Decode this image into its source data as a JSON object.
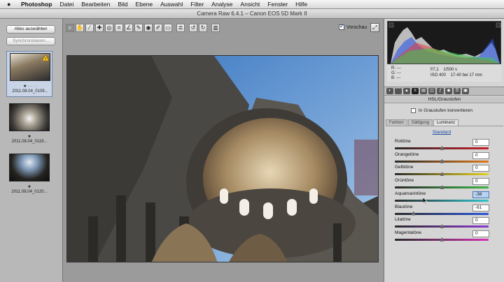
{
  "menubar": {
    "app": "Photoshop",
    "items": [
      "Datei",
      "Bearbeiten",
      "Bild",
      "Ebene",
      "Auswahl",
      "Filter",
      "Analyse",
      "Ansicht",
      "Fenster",
      "Hilfe"
    ]
  },
  "window": {
    "title": "Camera Raw 6.4.1  –  Canon EOS 5D Mark II"
  },
  "filmstrip": {
    "select_all_label": "Alles auswählen",
    "sync_label": "Synchronisieren...",
    "thumbnails": [
      {
        "caption": "2011.08.04_0109...",
        "stars": "★ · · · ·",
        "selected": true,
        "warning": true
      },
      {
        "caption": "2011.08.04_0119...",
        "stars": "★",
        "selected": false,
        "warning": false
      },
      {
        "caption": "2011.08.04_0120...",
        "stars": "★",
        "selected": false,
        "warning": false
      }
    ]
  },
  "toolbar": {
    "tools": [
      "zoom-tool",
      "hand-tool",
      "white-balance-tool",
      "color-sampler-tool",
      "targeted-adjustment-tool",
      "crop-tool",
      "straighten-tool",
      "spot-removal-tool",
      "red-eye-tool",
      "adjustment-brush-tool",
      "graduated-filter-tool",
      "preferences-tool",
      "rotate-ccw-tool",
      "rotate-cw-tool",
      "trash-tool"
    ],
    "preview_label": "Vorschau",
    "preview_checked": true
  },
  "info": {
    "r_label": "R:",
    "r_value": "---",
    "g_label": "G:",
    "g_value": "---",
    "b_label": "B:",
    "b_value": "---",
    "aperture": "f/7,1",
    "shutter": "1/500 s",
    "iso": "ISO 400",
    "lens": "17-40 bei 17 mm"
  },
  "panel": {
    "title": "HSL/Graustufen",
    "grayscale_label": "In Graustufen konvertieren",
    "subtabs": [
      "Farbton",
      "Sättigung",
      "Luminanz"
    ],
    "active_subtab": "Luminanz",
    "standard_label": "Standard",
    "sliders": [
      {
        "label": "Rottöne",
        "value": "0",
        "pos": 0.5,
        "colors": [
          "#2a2a2a",
          "#c8202a"
        ]
      },
      {
        "label": "Orangetöne",
        "value": "0",
        "pos": 0.5,
        "colors": [
          "#2a2a2a",
          "#e07a1c"
        ]
      },
      {
        "label": "Gelbtöne",
        "value": "0",
        "pos": 0.5,
        "colors": [
          "#2a2a2a",
          "#e6d21e"
        ]
      },
      {
        "label": "Grüntöne",
        "value": "0",
        "pos": 0.5,
        "colors": [
          "#2a2a2a",
          "#3fb545"
        ]
      },
      {
        "label": "Aquamarintöne",
        "value": "-38",
        "pos": 0.31,
        "colors": [
          "#2a2a2a",
          "#2fc6cf"
        ],
        "active": true
      },
      {
        "label": "Blautöne",
        "value": "-61",
        "pos": 0.195,
        "colors": [
          "#2a2a2a",
          "#2a56d8"
        ]
      },
      {
        "label": "Lilatöne",
        "value": "0",
        "pos": 0.5,
        "colors": [
          "#2a2a2a",
          "#8b3ad0"
        ]
      },
      {
        "label": "Magentatöne",
        "value": "0",
        "pos": 0.5,
        "colors": [
          "#2a2a2a",
          "#d633b5"
        ]
      }
    ]
  },
  "colors": {
    "accent": "#2d5fb0",
    "selection": "#c9d5e6"
  }
}
